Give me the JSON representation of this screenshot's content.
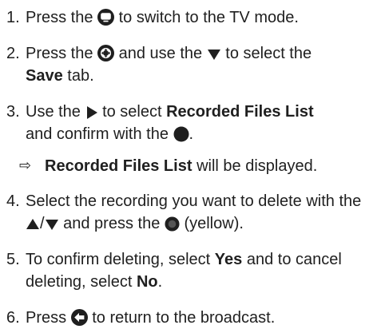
{
  "steps": [
    {
      "num": "1.",
      "parts": [
        "Press the",
        "to switch to the TV mode."
      ],
      "icons": [
        "tv-button-icon"
      ]
    },
    {
      "num": "2.",
      "parts": [
        "Press the",
        "and use the",
        "to select the",
        "Save",
        "tab."
      ],
      "icons": [
        "menu-button-icon",
        "down-arrow-icon"
      ]
    },
    {
      "num": "3.",
      "parts": [
        "Use the",
        "to select",
        "Recorded Files List",
        "and confirm with the",
        "."
      ],
      "icons": [
        "right-arrow-icon",
        "ok-button-icon"
      ]
    },
    {
      "num": "4.",
      "parts": [
        "Select the recording you want to delete with the",
        "/",
        "and press the",
        "(yellow)."
      ],
      "icons": [
        "up-arrow-icon",
        "down-arrow-icon",
        "yellow-button-icon"
      ]
    },
    {
      "num": "5.",
      "parts": [
        "To confirm deleting, select",
        "Yes",
        "and to cancel deleting, select",
        "No",
        "."
      ]
    },
    {
      "num": "6.",
      "parts": [
        "Press",
        "to return to the broadcast."
      ],
      "icons": [
        "back-button-icon"
      ]
    }
  ],
  "result": {
    "arrow": "⇨",
    "parts": [
      "Recorded Files List",
      "will be displayed."
    ]
  },
  "colors": {
    "text": "#1f1f1f",
    "icon": "#1f1f1f"
  }
}
